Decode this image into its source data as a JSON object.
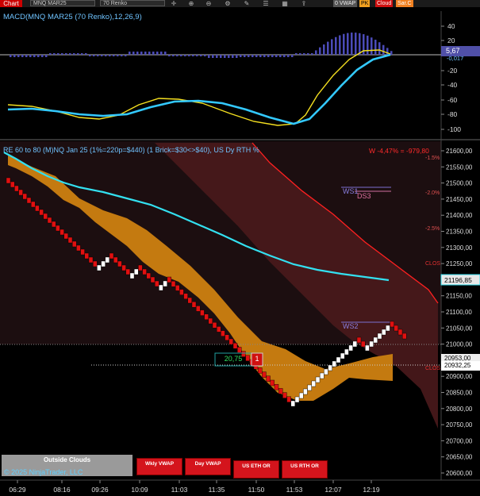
{
  "toolbar": {
    "chart_tab": "Chart",
    "instrument": "MNQ MAR25",
    "bar_type": "70 Renko",
    "icons": [
      "crosshair-icon",
      "zoom-in-icon",
      "zoom-out-icon",
      "settings-icon",
      "drawing-icon",
      "properties-icon",
      "chart-trader-icon",
      "share-icon"
    ],
    "tag_vwap": "0 VWAP",
    "tag_pk": "PK",
    "tag_cloud": "Cloud",
    "tag_sarcd": "Sar.C"
  },
  "macd": {
    "title": "MACD(MNQ MAR25 (70 Renko),12,26,9)",
    "current_value": "5,67",
    "second_value": "-0,017",
    "axis_labels": [
      "40",
      "20",
      "-20",
      "-40",
      "-60",
      "-80",
      "-100"
    ],
    "colors": {
      "macd": "#33c9ff",
      "signal": "#f5e020",
      "histogram": "#4b4bb8",
      "label_bg": "#5050a8"
    }
  },
  "price": {
    "title": "RE 60 to 80 (M)NQ Jan 25 (1%=220p=$440) (1 Brick=$30<>$40), US Dy RTH %",
    "warning": "W -4,47% = -979,80",
    "pct_levels": [
      "-1.5%",
      "-2.0%",
      "-2.5%"
    ],
    "clos_labels": [
      "CLOS",
      "CLOS"
    ],
    "ws1_label": "WS1",
    "ds3_label": "DS3",
    "ws2_label": "WS2",
    "price_box_value": "20,75",
    "price_box_count": "1",
    "axis_labels": [
      "21600,00",
      "21550,00",
      "21500,00",
      "21450,00",
      "21400,00",
      "21350,00",
      "21300,00",
      "21250,00",
      "21200,00",
      "21150,00",
      "21100,00",
      "21050,00",
      "21000,00",
      "20950,00",
      "20900,00",
      "20850,00",
      "20800,00",
      "20750,00",
      "20700,00",
      "20650,00",
      "20600,00"
    ],
    "price_tag_cyan": "21196,85",
    "price_tag_upper": "20953,00",
    "price_tag_lower": "20932,25",
    "colors": {
      "up_brick": "#ffffff",
      "down_brick": "#e01010",
      "orange_band": "#c47a10",
      "cyan_line": "#33e0f0",
      "red_cloud": "#5a1d1d",
      "red_line": "#ff2020"
    }
  },
  "buttons": {
    "outside_clouds": "Outside Clouds",
    "copyright": "© 2025 NinjaTrader, LLC",
    "wkly_vwap": "Wkly VWAP",
    "day_vwap": "Day VWAP",
    "us_eth_or": "US ETH OR",
    "us_rth_or": "US RTH OR"
  },
  "time_axis": [
    "06:29",
    "08:16",
    "09:26",
    "10:09",
    "11:03",
    "11:35",
    "11:50",
    "11:53",
    "12:07",
    "12:19"
  ]
}
